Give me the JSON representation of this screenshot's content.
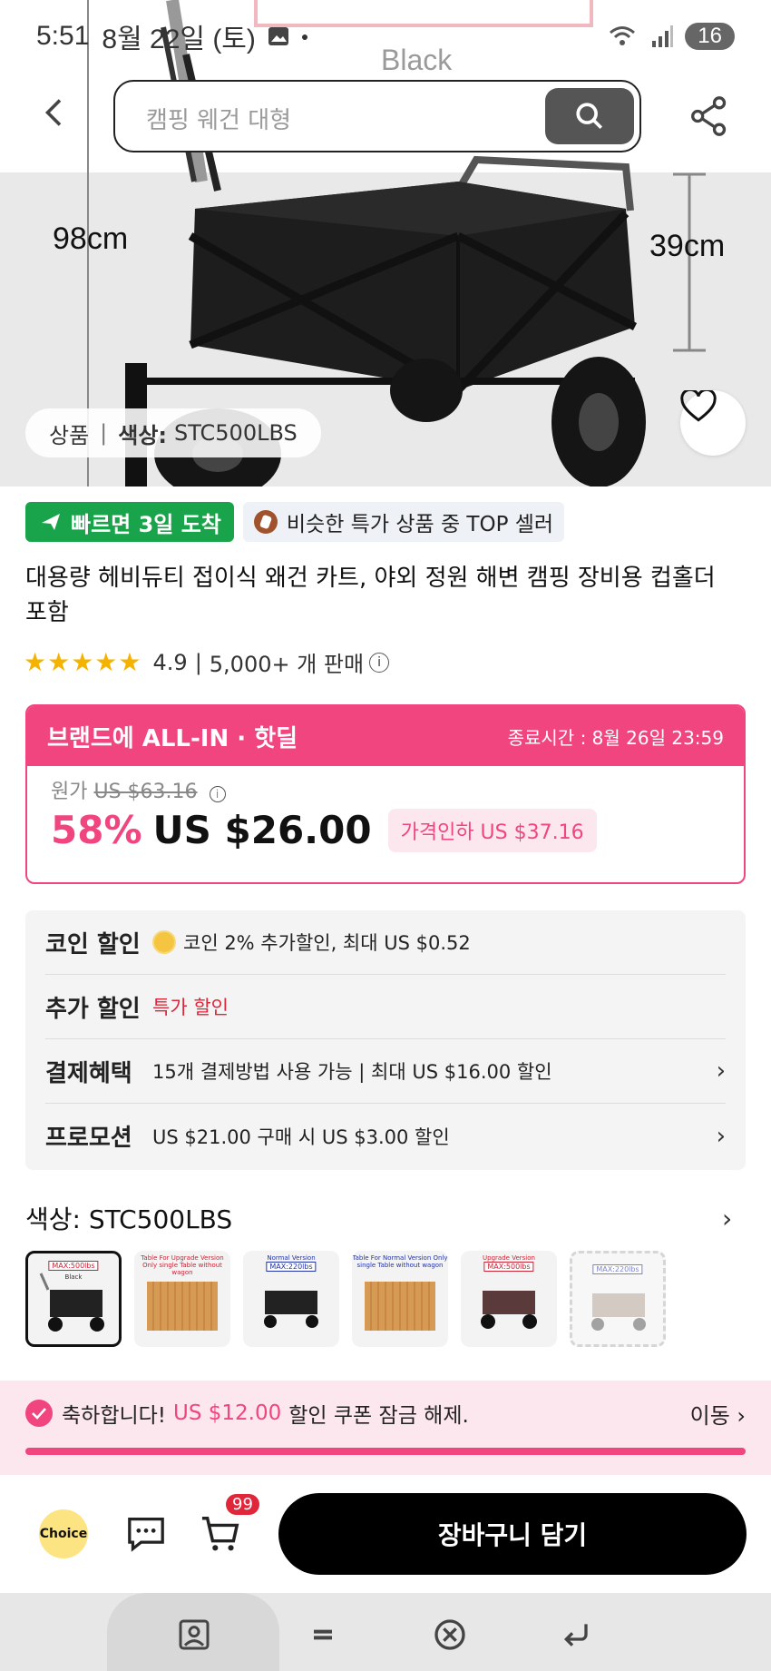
{
  "status_bar": {
    "time": "5:51",
    "date": "8월 22일 (토)",
    "battery": "16"
  },
  "hero": {
    "variant_label": "Black",
    "dim_height": "98cm",
    "dim_side": "39cm",
    "breadcrumb_product": "상품",
    "breadcrumb_sep": "|",
    "breadcrumb_color_label": "색상:",
    "breadcrumb_color_value": "STC500LBS"
  },
  "search": {
    "placeholder": "캠핑 웨건 대형"
  },
  "badges": {
    "fast": "빠르면 3일 도착",
    "top": "비슷한 특가 상품 중 TOP 셀러"
  },
  "product": {
    "title": "대용량 헤비듀티 접이식 왜건 카트, 야외 정원 해변 캠핑 장비용 컵홀더 포함",
    "stars": "★★★★★",
    "rating": "4.9",
    "sep": "|",
    "sold": "5,000+ 개 판매",
    "info": "i"
  },
  "deal": {
    "brand": "브랜드에 ALL-IN · 핫딜",
    "ends": "종료시간 : 8월 26일 23:59",
    "orig_label": "원가",
    "orig_price": "US $63.16",
    "discount": "58%",
    "price": "US $26.00",
    "price_drop": "가격인하 US $37.16"
  },
  "benefits": {
    "coin_label": "코인 할인",
    "coin_text": "코인 2% 추가할인, 최대 US $0.52",
    "extra_label": "추가 할인",
    "extra_text": "특가 할인",
    "pay_label": "결제혜택",
    "pay_text": "15개 결제방법 사용 가능 | 최대 US $16.00 할인",
    "promo_label": "프로모션",
    "promo_text": "US $21.00 구매 시 US $3.00 할인"
  },
  "color": {
    "title": "색상: STC500LBS",
    "options": [
      {
        "tag": "MAX:500lbs",
        "caption": "Black"
      },
      {
        "caption": "Table For Upgrade Version Only single Table without wagon"
      },
      {
        "caption": "Normal Version",
        "tag": "MAX:220lbs"
      },
      {
        "caption": "Table For Normal Version Only single Table without wagon"
      },
      {
        "caption": "Upgrade Version",
        "tag": "MAX:500lbs"
      },
      {
        "tag": "MAX:220lbs"
      }
    ]
  },
  "coupon": {
    "prefix": "축하합니다!",
    "amount": "US $12.00",
    "suffix": "할인 쿠폰 잠금 해제.",
    "action": "이동 ›"
  },
  "action_bar": {
    "choice": "Choice",
    "cart_count": "99",
    "add_to_cart": "장바구니 담기"
  },
  "colors": {
    "accent": "#f0457e",
    "fast": "#19a34a",
    "star": "#f5b301"
  }
}
